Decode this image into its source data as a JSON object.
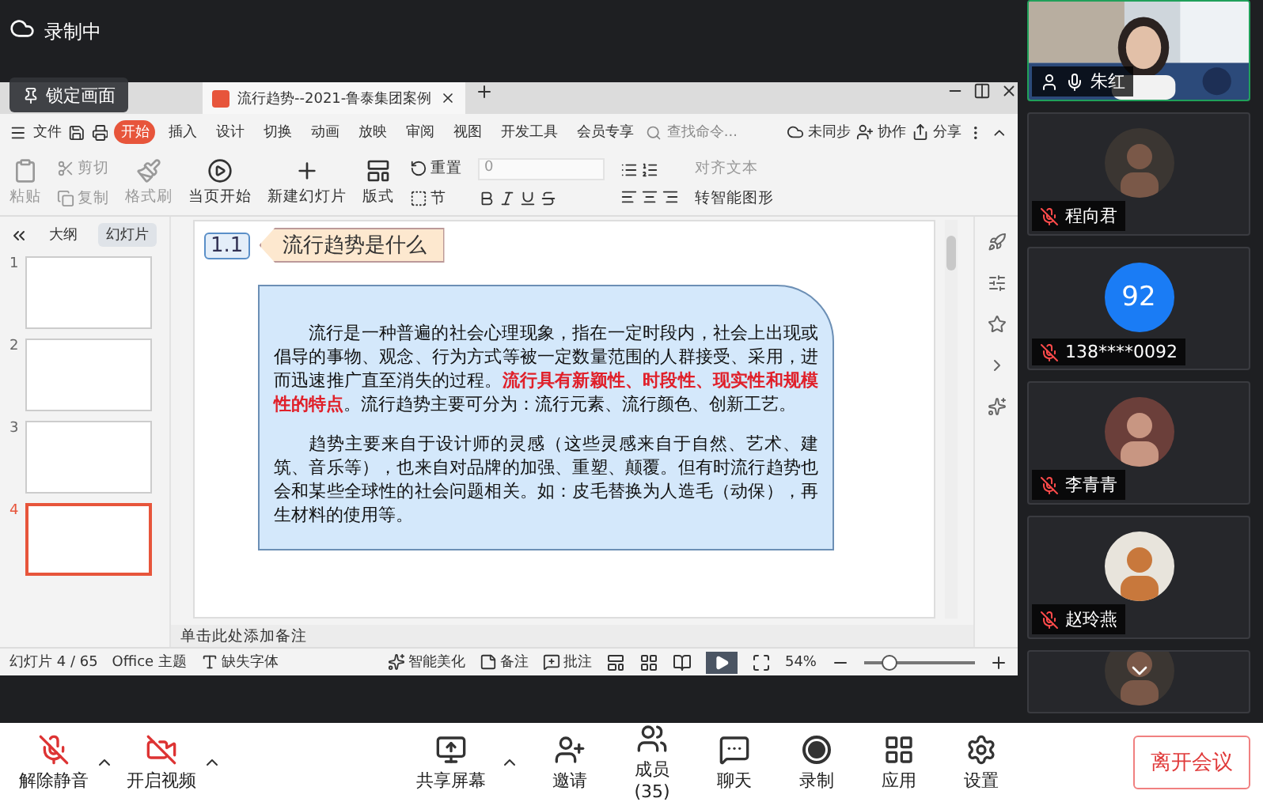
{
  "recording": {
    "label": "录制中"
  },
  "lock_screen": {
    "label": "锁定画面"
  },
  "wps": {
    "doc_tab": {
      "title": "流行趋势--2021-鲁泰集团案例"
    },
    "file_menu": "文件",
    "tabs": [
      {
        "label": "开始",
        "selected": true
      },
      {
        "label": "插入",
        "selected": false
      },
      {
        "label": "设计",
        "selected": false
      },
      {
        "label": "切换",
        "selected": false
      },
      {
        "label": "动画",
        "selected": false
      },
      {
        "label": "放映",
        "selected": false
      },
      {
        "label": "审阅",
        "selected": false
      },
      {
        "label": "视图",
        "selected": false
      },
      {
        "label": "开发工具",
        "selected": false
      },
      {
        "label": "会员专享",
        "selected": false
      }
    ],
    "search": {
      "placeholder": "查找命令..."
    },
    "actions": [
      "未同步",
      "协作",
      "分享"
    ],
    "ribbon": {
      "paste": "粘贴",
      "cut": "剪切",
      "copy": "复制",
      "format_painter": "格式刷",
      "play_current": "当页开始",
      "new_slide": "新建幻灯片",
      "layout": "版式",
      "reset": "重置",
      "section": "节",
      "font_size": "0",
      "align_text": "对齐文本",
      "smart_art": "转智能图形"
    },
    "panel_tabs": [
      {
        "label": "大纲",
        "selected": false
      },
      {
        "label": "幻灯片",
        "selected": true
      }
    ],
    "thumbnails": [
      {
        "number": "1",
        "selected": false
      },
      {
        "number": "2",
        "selected": false
      },
      {
        "number": "3",
        "selected": false
      },
      {
        "number": "4",
        "selected": true
      }
    ],
    "slide": {
      "number": "1.1",
      "heading": "流行趋势是什么",
      "paragraphs": [
        [
          {
            "text": "流行是一种普遍的社会心理现象，指在一定时段内，社会上出现或倡导的事物、观念、行为方式等被一定数量范围的人群接受、采用，进而迅速推广直至消失的过程。",
            "emphasis": false
          },
          {
            "text": "流行具有新颖性、时段性、现实性和规模性的特点",
            "emphasis": true
          },
          {
            "text": "。流行趋势主要可分为：流行元素、流行颜色、创新工艺。",
            "emphasis": false
          }
        ],
        [
          {
            "text": "趋势主要来自于设计师的灵感（这些灵感来自于自然、艺术、建筑、音乐等），也来自对品牌的加强、重塑、颠覆。但有时流行趋势也会和某些全球性的社会问题相关。如：皮毛替换为人造毛（动保），再生材料的使用等。",
            "emphasis": false
          }
        ]
      ]
    },
    "notes_placeholder": "单击此处添加备注",
    "status": {
      "slide_count": "幻灯片 4 / 65",
      "theme": "Office 主题",
      "missing_font": "缺失字体",
      "beautify": "智能美化",
      "notes": "备注",
      "comments": "批注",
      "zoom": "54%",
      "zoom_slider": {
        "level": 0.23
      }
    }
  },
  "participants": [
    {
      "name": "朱红",
      "kind": "video",
      "muted": false,
      "speaking": true
    },
    {
      "name": "程向君",
      "kind": "avatar",
      "muted": true,
      "speaking": false
    },
    {
      "name": "138****0092",
      "kind": "initials",
      "initials": "92",
      "muted": true,
      "speaking": false
    },
    {
      "name": "李青青",
      "kind": "avatar",
      "muted": true,
      "speaking": false
    },
    {
      "name": "赵玲燕",
      "kind": "avatar",
      "muted": true,
      "speaking": false
    },
    {
      "kind": "partial",
      "speaking": false
    }
  ],
  "toolbar": [
    {
      "kind": "mic",
      "label": "解除静音",
      "menu": true
    },
    {
      "kind": "video",
      "label": "开启视频",
      "menu": true
    },
    {
      "kind": "share",
      "label": "共享屏幕",
      "menu": true
    },
    {
      "kind": "invite",
      "label": "邀请",
      "menu": false
    },
    {
      "kind": "members",
      "label": "成员(35)",
      "menu": false
    },
    {
      "kind": "chat",
      "label": "聊天",
      "menu": false
    },
    {
      "kind": "record",
      "label": "录制",
      "menu": false
    },
    {
      "kind": "apps",
      "label": "应用",
      "menu": false
    },
    {
      "kind": "settings",
      "label": "设置",
      "menu": false
    }
  ],
  "leave": "离开会议"
}
